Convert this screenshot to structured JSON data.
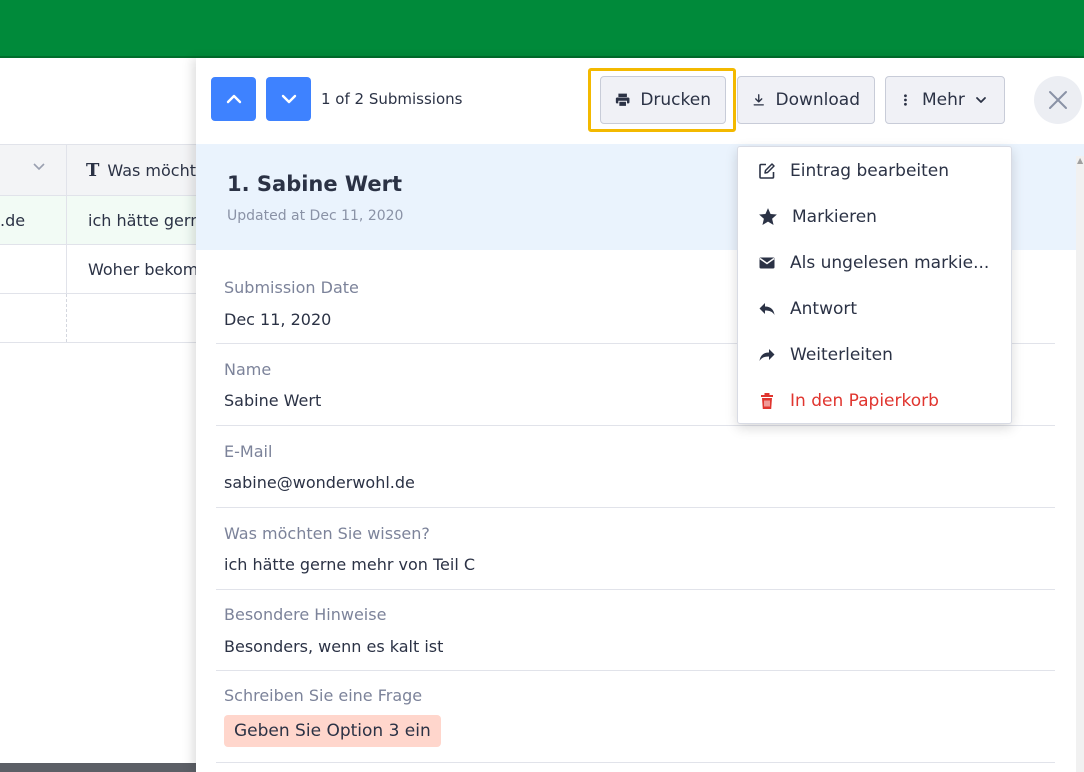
{
  "background_table": {
    "header_col_b": "Was möchten",
    "rows": [
      {
        "col_a": ".de",
        "col_b": "ich hätte gerne mehr"
      },
      {
        "col_a": "",
        "col_b": "Woher bekomme"
      }
    ]
  },
  "panel": {
    "counter": "1 of 2 Submissions",
    "toolbar": {
      "print_label": "Drucken",
      "download_label": "Download",
      "more_label": "Mehr"
    },
    "entry": {
      "title": "1. Sabine Wert",
      "updated": "Updated at Dec 11, 2020"
    },
    "fields": [
      {
        "label": "Submission Date",
        "value": "Dec 11, 2020"
      },
      {
        "label": "Name",
        "value": "Sabine Wert"
      },
      {
        "label": "E-Mail",
        "value": "sabine@wonderwohl.de"
      },
      {
        "label": "Was möchten Sie wissen?",
        "value": "ich hätte gerne mehr von Teil C"
      },
      {
        "label": "Besondere Hinweise",
        "value": "Besonders, wenn es kalt ist"
      },
      {
        "label": "Schreiben Sie eine Frage",
        "value": "Geben Sie Option 3 ein"
      }
    ]
  },
  "menu": {
    "items": [
      {
        "label": "Eintrag bearbeiten",
        "icon": "edit-icon"
      },
      {
        "label": "Markieren",
        "icon": "star-icon"
      },
      {
        "label": "Als ungelesen markie...",
        "icon": "envelope-icon"
      },
      {
        "label": "Antwort",
        "icon": "reply-icon"
      },
      {
        "label": "Weiterleiten",
        "icon": "forward-icon"
      },
      {
        "label": "In den Papierkorb",
        "icon": "trash-icon"
      }
    ]
  },
  "colors": {
    "topbar": "#008a3a",
    "accent": "#3e82ff",
    "highlight": "#f3b900",
    "danger": "#e0352f",
    "entry_head": "#eaf3fd",
    "tag": "#ffd6cc"
  }
}
